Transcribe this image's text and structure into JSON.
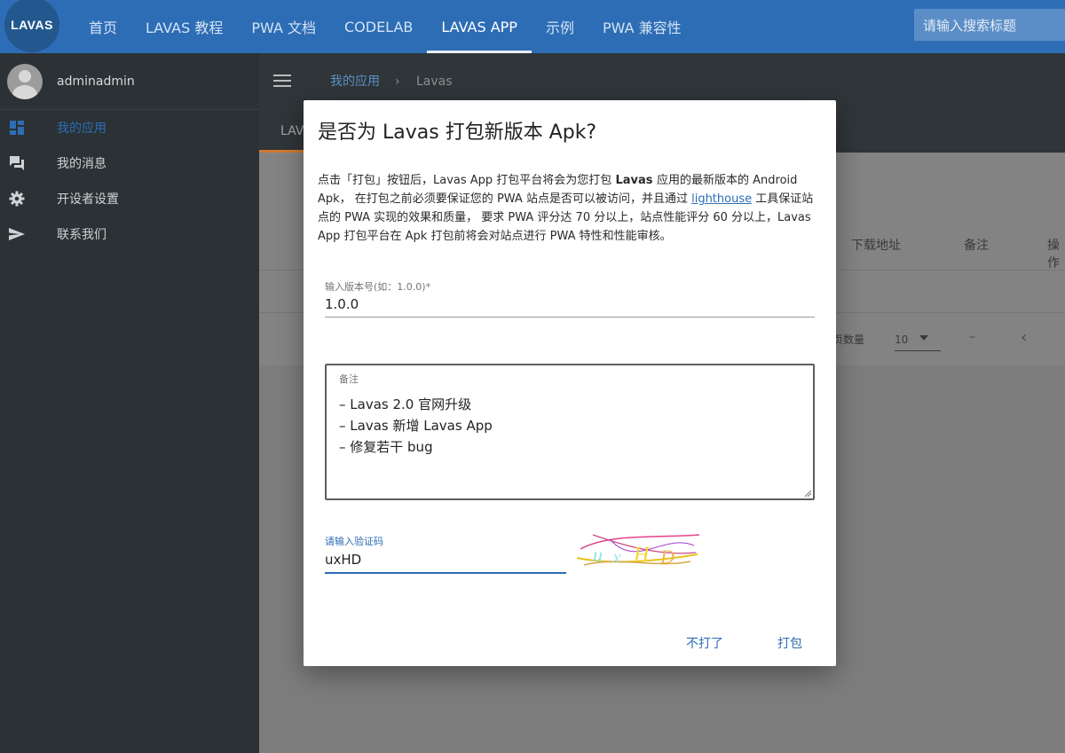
{
  "topbar": {
    "logo": "LAVAS",
    "nav": [
      "首页",
      "LAVAS 教程",
      "PWA 文档",
      "CODELAB",
      "LAVAS APP",
      "示例",
      "PWA 兼容性"
    ],
    "active_nav": "LAVAS APP",
    "search_placeholder": "请输入搜索标题"
  },
  "sidebar": {
    "user_name": "adminadmin",
    "items": [
      {
        "label": "我的应用",
        "icon": "dashboard-icon",
        "active": true
      },
      {
        "label": "我的消息",
        "icon": "chat-icon",
        "active": false
      },
      {
        "label": "开设者设置",
        "icon": "gear-icon",
        "active": false
      },
      {
        "label": "联系我们",
        "icon": "send-icon",
        "active": false
      }
    ]
  },
  "content": {
    "breadcrumb": {
      "link": "我的应用",
      "separator": "›",
      "current": "Lavas"
    },
    "tab_partial": "LAV",
    "table_headers": [
      "下载地址",
      "备注",
      "操作"
    ],
    "pager": {
      "label": "页数量",
      "page_size": "10",
      "range": "–",
      "prev": "‹"
    }
  },
  "dialog": {
    "title": "是否为 Lavas 打包新版本 Apk?",
    "desc": {
      "part1": "点击「打包」按钮后，Lavas App 打包平台将会为您打包 ",
      "app_name": " Lavas ",
      "part2": " 应用的最新版本的 Android Apk， 在打包之前必须要保证您的 PWA 站点是否可以被访问，并且通过 ",
      "link": "lighthouse",
      "part3": " 工具保证站点的 PWA 实现的效果和质量， 要求 PWA 评分达 70 分以上，站点性能评分 60 分以上，Lavas App 打包平台在 Apk 打包前将会对站点进行 PWA 特性和性能审核。"
    },
    "version_label": "输入版本号(如：1.0.0)*",
    "version_value": "1.0.0",
    "note_label": "备注",
    "note_lines": [
      "– Lavas 2.0 官网升级",
      "– Lavas 新增 Lavas App",
      "– 修复若干 bug"
    ],
    "captcha_label": "请输入验证码",
    "captcha_value": "uxHD",
    "cancel": "不打了",
    "confirm": "打包"
  }
}
